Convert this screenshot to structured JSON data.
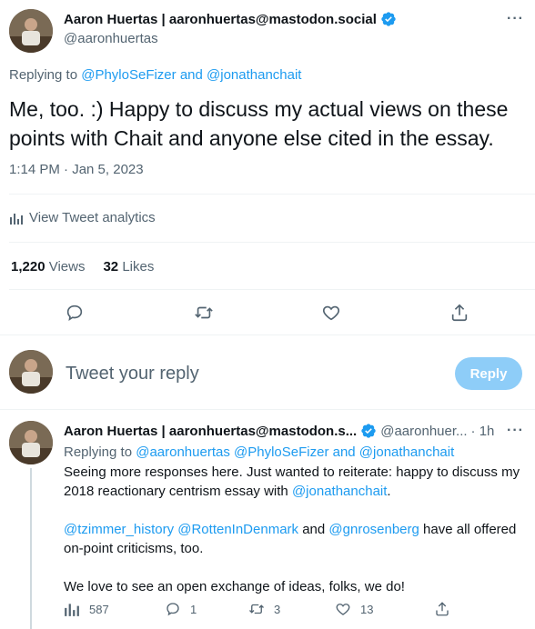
{
  "main_tweet": {
    "display_name": "Aaron Huertas | aaronhuertas@mastodon.social",
    "handle": "@aaronhuertas",
    "replying_prefix": "Replying to",
    "replying_to": "@PhyloSeFizer and @jonathanchait",
    "text_line1": "Me, too. :) Happy to discuss my actual views on these",
    "text_line2": "points with Chait and anyone else cited in the essay.",
    "timestamp": "1:14 PM · Jan 5, 2023",
    "analytics_label": "View Tweet analytics",
    "views_count": "1,220",
    "views_label": "Views",
    "likes_count": "32",
    "likes_label": "Likes"
  },
  "composer": {
    "placeholder": "Tweet your reply",
    "button_label": "Reply"
  },
  "reply_tweet": {
    "display_name": "Aaron Huertas | aaronhuertas@mastodon.s...",
    "handle": "@aaronhuer...",
    "time": "· 1h",
    "replying_prefix": "Replying to",
    "replying_to": "@aaronhuertas @PhyloSeFizer and @jonathanchait",
    "p1_text": "Seeing more responses here. Just wanted to reiterate: happy to discuss my 2018 reactionary centrism essay with ",
    "p1_mention": "@jonathanchait",
    "p1_end": ".",
    "p2_mention1": "@tzimmer_history",
    "p2_mention2": "@RottenInDenmark",
    "p2_and": " and ",
    "p2_mention3": "@gnrosenberg",
    "p2_text": " have all offered on-point criticisms, too.",
    "p3_text": "We love to see an open exchange of ideas, folks, we do!",
    "views": "587",
    "replies": "1",
    "retweets": "3",
    "likes": "13"
  },
  "colors": {
    "accent": "#1d9bf0",
    "muted": "#536471",
    "reply_button": "#8ecdf8",
    "divider": "#eff3f4"
  },
  "icons": [
    "more-icon",
    "verified-badge-icon",
    "analytics-icon",
    "reply-icon",
    "retweet-icon",
    "like-icon",
    "share-icon",
    "views-icon"
  ]
}
